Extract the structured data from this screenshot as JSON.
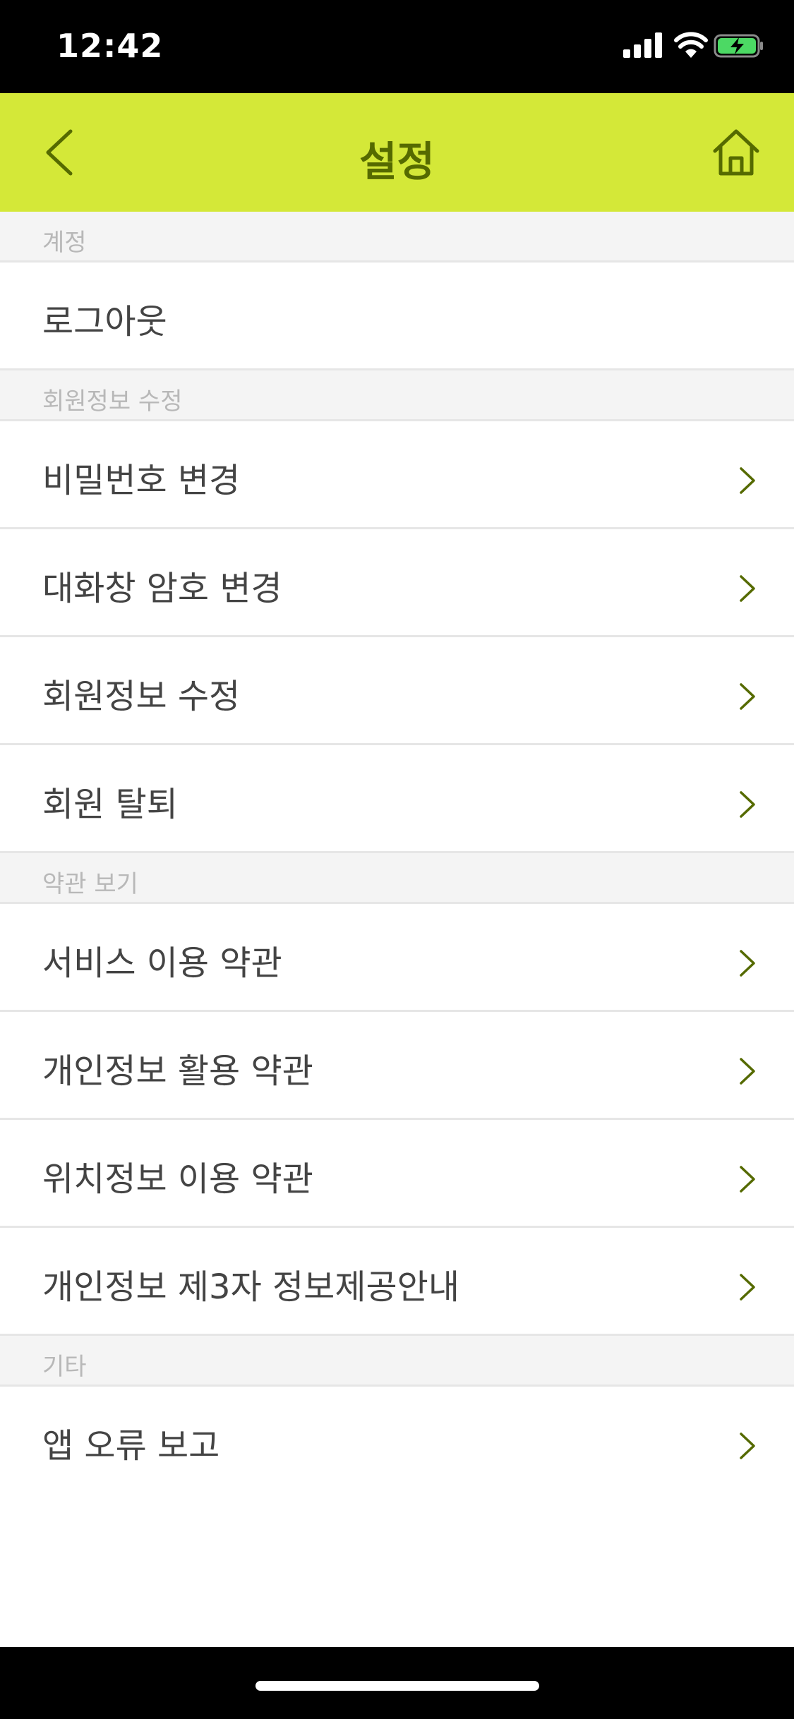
{
  "status": {
    "time": "12:42"
  },
  "header": {
    "title": "설정",
    "background": "#d4e838",
    "accent": "#556a00"
  },
  "sections": [
    {
      "title": "계정",
      "items": [
        {
          "label": "로그아웃",
          "chevron": false
        }
      ]
    },
    {
      "title": "회원정보 수정",
      "items": [
        {
          "label": "비밀번호 변경",
          "chevron": true
        },
        {
          "label": "대화창 암호 변경",
          "chevron": true
        },
        {
          "label": "회원정보 수정",
          "chevron": true
        },
        {
          "label": "회원 탈퇴",
          "chevron": true
        }
      ]
    },
    {
      "title": "약관 보기",
      "items": [
        {
          "label": "서비스 이용 약관",
          "chevron": true
        },
        {
          "label": "개인정보 활용 약관",
          "chevron": true
        },
        {
          "label": "위치정보 이용 약관",
          "chevron": true
        },
        {
          "label": "개인정보 제3자 정보제공안내",
          "chevron": true
        }
      ]
    },
    {
      "title": "기타",
      "items": [
        {
          "label": "앱 오류 보고",
          "chevron": true
        }
      ]
    }
  ],
  "icons": {
    "back": "chevron-left-icon",
    "home": "home-icon",
    "row": "chevron-right-icon"
  }
}
